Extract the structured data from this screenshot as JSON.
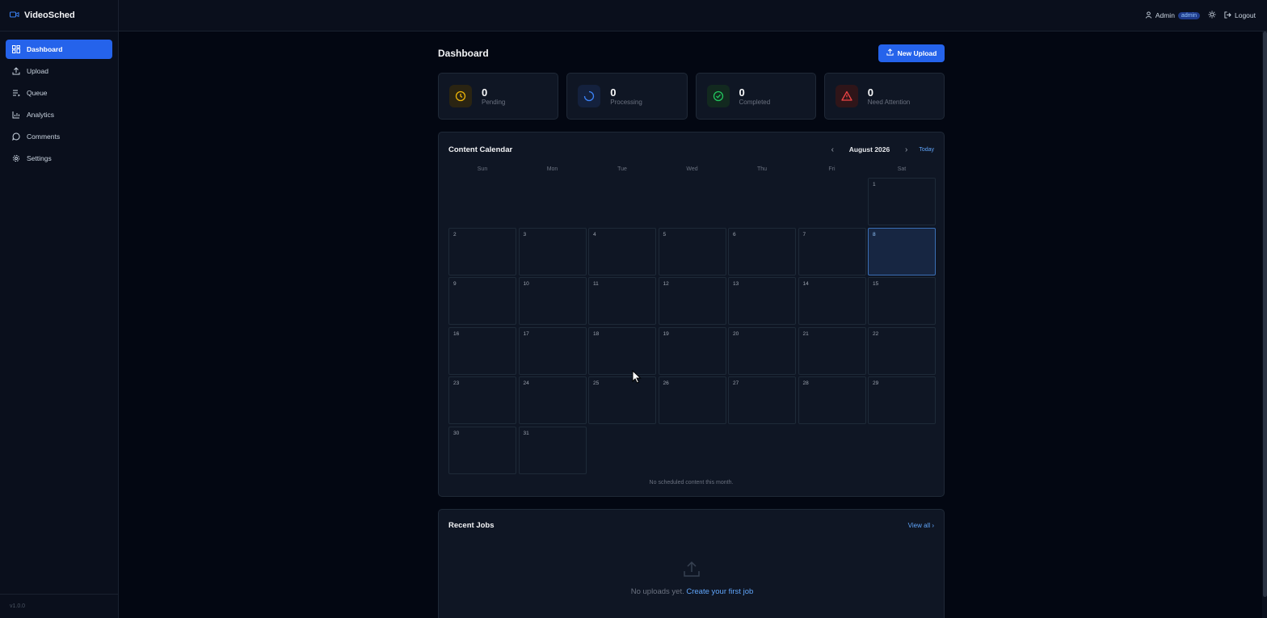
{
  "app": {
    "name": "VideoSched",
    "version": "v1.0.0"
  },
  "sidebar": {
    "items": [
      {
        "label": "Dashboard",
        "icon": "dashboard-icon"
      },
      {
        "label": "Upload",
        "icon": "upload-icon"
      },
      {
        "label": "Queue",
        "icon": "queue-icon"
      },
      {
        "label": "Analytics",
        "icon": "analytics-icon"
      },
      {
        "label": "Comments",
        "icon": "comments-icon"
      },
      {
        "label": "Settings",
        "icon": "gear-icon"
      }
    ],
    "active": "Dashboard"
  },
  "topbar": {
    "user": "Admin",
    "role": "admin",
    "logout_label": "Logout"
  },
  "page": {
    "title": "Dashboard",
    "new_upload_label": "New Upload"
  },
  "stats": [
    {
      "value": "0",
      "label": "Pending",
      "color": "#eab308"
    },
    {
      "value": "0",
      "label": "Processing",
      "color": "#3b82f6"
    },
    {
      "value": "0",
      "label": "Completed",
      "color": "#22c55e"
    },
    {
      "value": "0",
      "label": "Need Attention",
      "color": "#ef4444"
    }
  ],
  "calendar": {
    "title": "Content Calendar",
    "month": "August 2026",
    "today_label": "Today",
    "weekdays": [
      "Sun",
      "Mon",
      "Tue",
      "Wed",
      "Thu",
      "Fri",
      "Sat"
    ],
    "days": [
      "1",
      "2",
      "3",
      "4",
      "5",
      "6",
      "7",
      "8",
      "9",
      "10",
      "11",
      "12",
      "13",
      "14",
      "15",
      "16",
      "17",
      "18",
      "19",
      "20",
      "21",
      "22",
      "23",
      "24",
      "25",
      "26",
      "27",
      "28",
      "29",
      "30",
      "31"
    ],
    "today": "8",
    "empty_message": "No scheduled content this month."
  },
  "recent_jobs": {
    "title": "Recent Jobs",
    "view_all_label": "View all",
    "empty_text": "No uploads yet.",
    "empty_link": "Create your first job"
  },
  "colors": {
    "accent": "#2563eb",
    "link": "#60a5fa"
  }
}
